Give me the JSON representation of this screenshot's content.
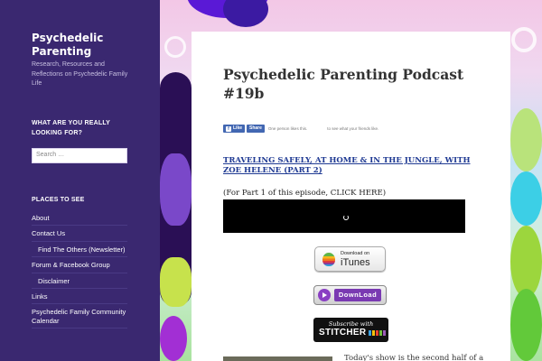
{
  "site": {
    "title": "Psychedelic Parenting",
    "description": "Research, Resources and Reflections on Psychedelic Family Life"
  },
  "search_widget": {
    "heading": "WHAT ARE YOU REALLY LOOKING FOR?",
    "placeholder": "Search …"
  },
  "places_widget": {
    "heading": "PLACES TO SEE",
    "items": [
      {
        "label": "About"
      },
      {
        "label": "Contact Us"
      },
      {
        "label": "Find The Others (Newsletter)"
      },
      {
        "label": "Forum & Facebook Group"
      },
      {
        "label": "Disclaimer"
      },
      {
        "label": "Links"
      },
      {
        "label": "Psychedelic Family Community Calendar"
      }
    ]
  },
  "post": {
    "title": "Psychedelic Parenting Podcast #19b",
    "facebook": {
      "like_label": "Like",
      "share_label": "Share",
      "likes_text": "One person likes this.",
      "friends_text": "to see what your friends like."
    },
    "subtitle": "TRAVELING SAFELY, AT HOME & IN THE JUNGLE, WITH ZOE HELENE (PART 2)",
    "part1_text": "(For Part 1 of this episode, CLICK HERE)",
    "itunes": {
      "small": "Download on",
      "big": "iTunes"
    },
    "download_label": "DownLoad",
    "stitcher": {
      "small": "Subscribe with",
      "big": "STITCHER"
    },
    "body_start": "Today's show is the second half of a"
  },
  "colors": {
    "sidebar_bg": "#3a2870",
    "link_blue": "#1f3a93",
    "facebook_blue": "#4267b2"
  }
}
